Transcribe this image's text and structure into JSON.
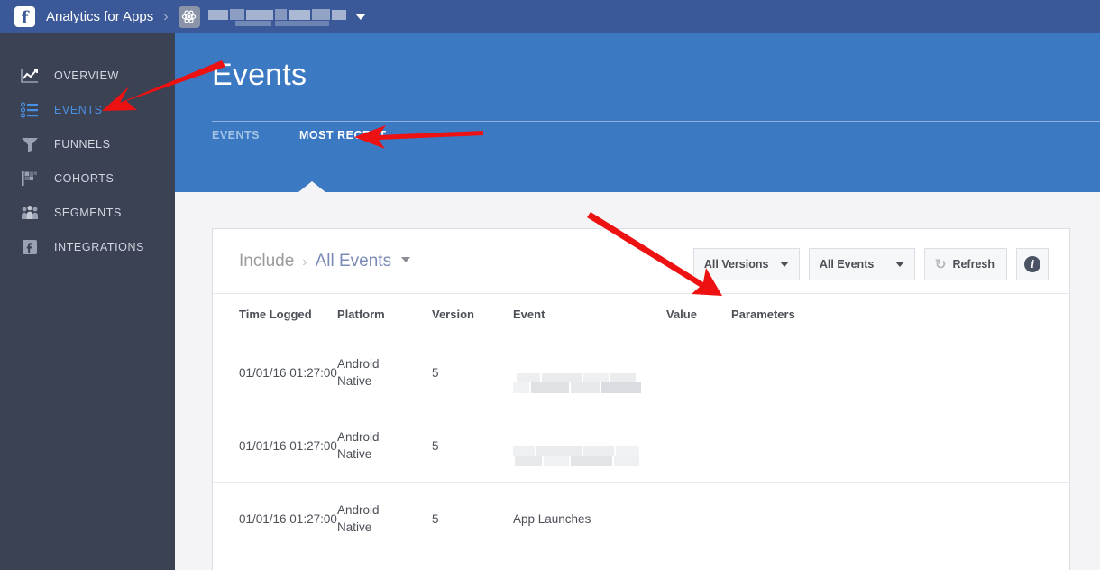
{
  "topbar": {
    "logo_letter": "f",
    "brand": "Analytics for Apps",
    "separator": "›",
    "gear_icon": "settings-atom-icon",
    "app_name_redacted": "",
    "dropdown_caret": ""
  },
  "sidebar": {
    "items": [
      {
        "id": "overview",
        "label": "OVERVIEW",
        "icon": "line-chart-icon",
        "active": false
      },
      {
        "id": "events",
        "label": "EVENTS",
        "icon": "list-icon",
        "active": true
      },
      {
        "id": "funnels",
        "label": "FUNNELS",
        "icon": "funnel-icon",
        "active": false
      },
      {
        "id": "cohorts",
        "label": "COHORTS",
        "icon": "flag-icon",
        "active": false
      },
      {
        "id": "segments",
        "label": "SEGMENTS",
        "icon": "people-icon",
        "active": false
      },
      {
        "id": "integrations",
        "label": "INTEGRATIONS",
        "icon": "facebook-icon",
        "active": false
      }
    ]
  },
  "page": {
    "title": "Events",
    "tabs": [
      {
        "id": "events",
        "label": "EVENTS",
        "active": false
      },
      {
        "id": "most-recent",
        "label": "MOST RECENT",
        "active": true
      }
    ]
  },
  "toolbar": {
    "include_label": "Include",
    "include_separator": "›",
    "include_value": "All Events",
    "versions_filter": "All Versions",
    "events_filter": "All Events",
    "refresh_label": "Refresh",
    "refresh_icon": "refresh-icon",
    "info_icon": "info-icon",
    "info_glyph": "i"
  },
  "table": {
    "columns": [
      "Time Logged",
      "Platform",
      "Version",
      "Event",
      "Value",
      "Parameters"
    ],
    "rows": [
      {
        "time": "01/01/16 01:27:00",
        "platform_line1": "Android",
        "platform_line2": "Native",
        "version": "5",
        "event": "",
        "event_redacted": true,
        "value": "",
        "parameters": ""
      },
      {
        "time": "01/01/16 01:27:00",
        "platform_line1": "Android",
        "platform_line2": "Native",
        "version": "5",
        "event": "",
        "event_redacted": true,
        "value": "",
        "parameters": ""
      },
      {
        "time": "01/01/16 01:27:00",
        "platform_line1": "Android",
        "platform_line2": "Native",
        "version": "5",
        "event": "App Launches",
        "event_redacted": false,
        "value": "",
        "parameters": ""
      }
    ]
  },
  "annotations": {
    "color": "#ee1111",
    "arrows": [
      {
        "id": "arrow-to-events-nav",
        "target": "sidebar EVENTS"
      },
      {
        "id": "arrow-to-most-recent",
        "target": "MOST RECENT tab"
      },
      {
        "id": "arrow-to-value",
        "target": "Value column header"
      }
    ]
  },
  "colors": {
    "topbar": "#3b5998",
    "sidebar": "#3b4254",
    "header_blue": "#3b79c3",
    "accent_blue": "#4a90e2",
    "page_bg": "#f4f4f6",
    "annotation_red": "#ee1111"
  }
}
